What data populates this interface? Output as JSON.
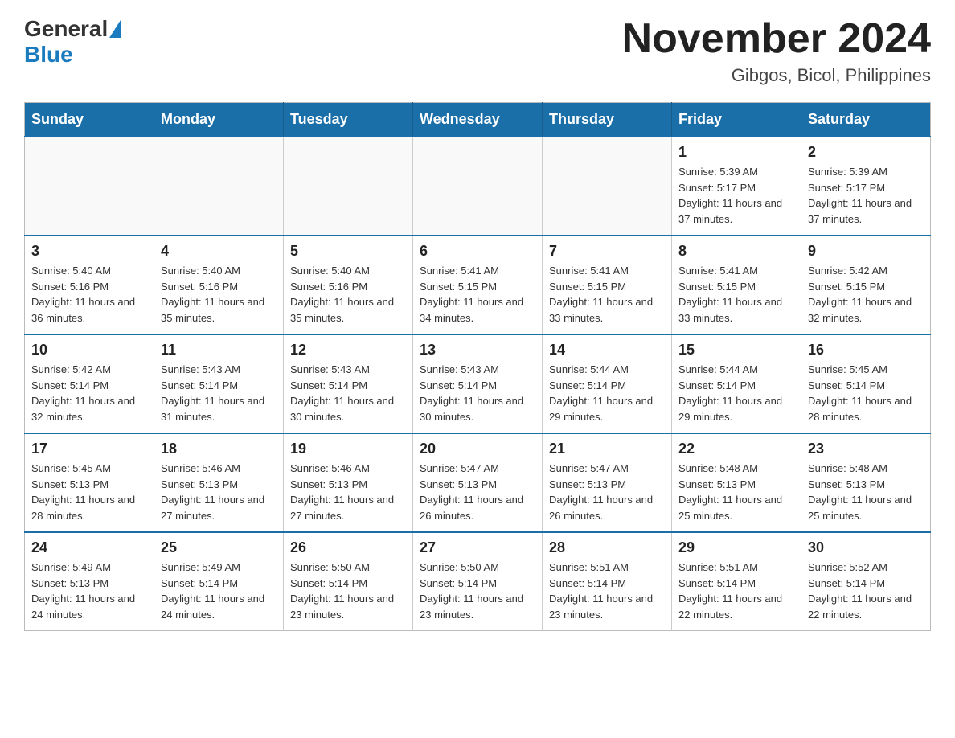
{
  "header": {
    "logo": {
      "general": "General",
      "blue": "Blue"
    },
    "title": "November 2024",
    "location": "Gibgos, Bicol, Philippines"
  },
  "calendar": {
    "weekdays": [
      "Sunday",
      "Monday",
      "Tuesday",
      "Wednesday",
      "Thursday",
      "Friday",
      "Saturday"
    ],
    "weeks": [
      [
        {
          "day": "",
          "info": ""
        },
        {
          "day": "",
          "info": ""
        },
        {
          "day": "",
          "info": ""
        },
        {
          "day": "",
          "info": ""
        },
        {
          "day": "",
          "info": ""
        },
        {
          "day": "1",
          "info": "Sunrise: 5:39 AM\nSunset: 5:17 PM\nDaylight: 11 hours and 37 minutes."
        },
        {
          "day": "2",
          "info": "Sunrise: 5:39 AM\nSunset: 5:17 PM\nDaylight: 11 hours and 37 minutes."
        }
      ],
      [
        {
          "day": "3",
          "info": "Sunrise: 5:40 AM\nSunset: 5:16 PM\nDaylight: 11 hours and 36 minutes."
        },
        {
          "day": "4",
          "info": "Sunrise: 5:40 AM\nSunset: 5:16 PM\nDaylight: 11 hours and 35 minutes."
        },
        {
          "day": "5",
          "info": "Sunrise: 5:40 AM\nSunset: 5:16 PM\nDaylight: 11 hours and 35 minutes."
        },
        {
          "day": "6",
          "info": "Sunrise: 5:41 AM\nSunset: 5:15 PM\nDaylight: 11 hours and 34 minutes."
        },
        {
          "day": "7",
          "info": "Sunrise: 5:41 AM\nSunset: 5:15 PM\nDaylight: 11 hours and 33 minutes."
        },
        {
          "day": "8",
          "info": "Sunrise: 5:41 AM\nSunset: 5:15 PM\nDaylight: 11 hours and 33 minutes."
        },
        {
          "day": "9",
          "info": "Sunrise: 5:42 AM\nSunset: 5:15 PM\nDaylight: 11 hours and 32 minutes."
        }
      ],
      [
        {
          "day": "10",
          "info": "Sunrise: 5:42 AM\nSunset: 5:14 PM\nDaylight: 11 hours and 32 minutes."
        },
        {
          "day": "11",
          "info": "Sunrise: 5:43 AM\nSunset: 5:14 PM\nDaylight: 11 hours and 31 minutes."
        },
        {
          "day": "12",
          "info": "Sunrise: 5:43 AM\nSunset: 5:14 PM\nDaylight: 11 hours and 30 minutes."
        },
        {
          "day": "13",
          "info": "Sunrise: 5:43 AM\nSunset: 5:14 PM\nDaylight: 11 hours and 30 minutes."
        },
        {
          "day": "14",
          "info": "Sunrise: 5:44 AM\nSunset: 5:14 PM\nDaylight: 11 hours and 29 minutes."
        },
        {
          "day": "15",
          "info": "Sunrise: 5:44 AM\nSunset: 5:14 PM\nDaylight: 11 hours and 29 minutes."
        },
        {
          "day": "16",
          "info": "Sunrise: 5:45 AM\nSunset: 5:14 PM\nDaylight: 11 hours and 28 minutes."
        }
      ],
      [
        {
          "day": "17",
          "info": "Sunrise: 5:45 AM\nSunset: 5:13 PM\nDaylight: 11 hours and 28 minutes."
        },
        {
          "day": "18",
          "info": "Sunrise: 5:46 AM\nSunset: 5:13 PM\nDaylight: 11 hours and 27 minutes."
        },
        {
          "day": "19",
          "info": "Sunrise: 5:46 AM\nSunset: 5:13 PM\nDaylight: 11 hours and 27 minutes."
        },
        {
          "day": "20",
          "info": "Sunrise: 5:47 AM\nSunset: 5:13 PM\nDaylight: 11 hours and 26 minutes."
        },
        {
          "day": "21",
          "info": "Sunrise: 5:47 AM\nSunset: 5:13 PM\nDaylight: 11 hours and 26 minutes."
        },
        {
          "day": "22",
          "info": "Sunrise: 5:48 AM\nSunset: 5:13 PM\nDaylight: 11 hours and 25 minutes."
        },
        {
          "day": "23",
          "info": "Sunrise: 5:48 AM\nSunset: 5:13 PM\nDaylight: 11 hours and 25 minutes."
        }
      ],
      [
        {
          "day": "24",
          "info": "Sunrise: 5:49 AM\nSunset: 5:13 PM\nDaylight: 11 hours and 24 minutes."
        },
        {
          "day": "25",
          "info": "Sunrise: 5:49 AM\nSunset: 5:14 PM\nDaylight: 11 hours and 24 minutes."
        },
        {
          "day": "26",
          "info": "Sunrise: 5:50 AM\nSunset: 5:14 PM\nDaylight: 11 hours and 23 minutes."
        },
        {
          "day": "27",
          "info": "Sunrise: 5:50 AM\nSunset: 5:14 PM\nDaylight: 11 hours and 23 minutes."
        },
        {
          "day": "28",
          "info": "Sunrise: 5:51 AM\nSunset: 5:14 PM\nDaylight: 11 hours and 23 minutes."
        },
        {
          "day": "29",
          "info": "Sunrise: 5:51 AM\nSunset: 5:14 PM\nDaylight: 11 hours and 22 minutes."
        },
        {
          "day": "30",
          "info": "Sunrise: 5:52 AM\nSunset: 5:14 PM\nDaylight: 11 hours and 22 minutes."
        }
      ]
    ]
  }
}
